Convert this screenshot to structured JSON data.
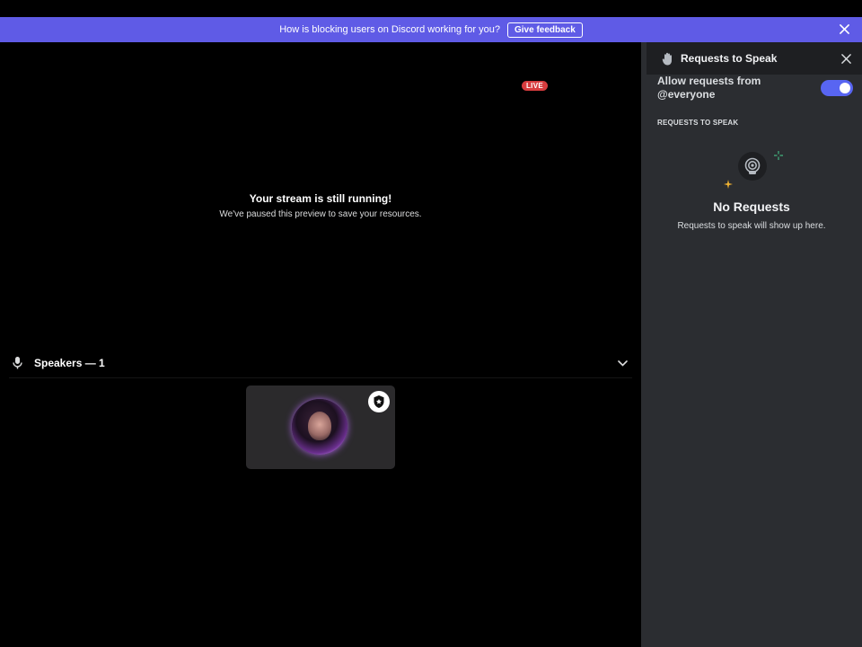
{
  "banner": {
    "message": "How is blocking users on Discord working for you?",
    "feedback_label": "Give feedback"
  },
  "stage": {
    "live_badge": "LIVE",
    "paused_title": "Your stream is still running!",
    "paused_subtitle": "We've paused this preview to save your resources."
  },
  "speakers": {
    "header_label": "Speakers — 1"
  },
  "panel": {
    "title": "Requests to Speak",
    "allow_label": "Allow requests from @everyone",
    "allow_enabled": true,
    "section_label": "REQUESTS TO SPEAK",
    "empty_title": "No Requests",
    "empty_subtitle": "Requests to speak will show up here."
  },
  "colors": {
    "banner_bg": "#5f5be6",
    "live_red": "#d83c3e",
    "toggle_blurple": "#5865f2",
    "panel_bg": "#2b2d31"
  }
}
